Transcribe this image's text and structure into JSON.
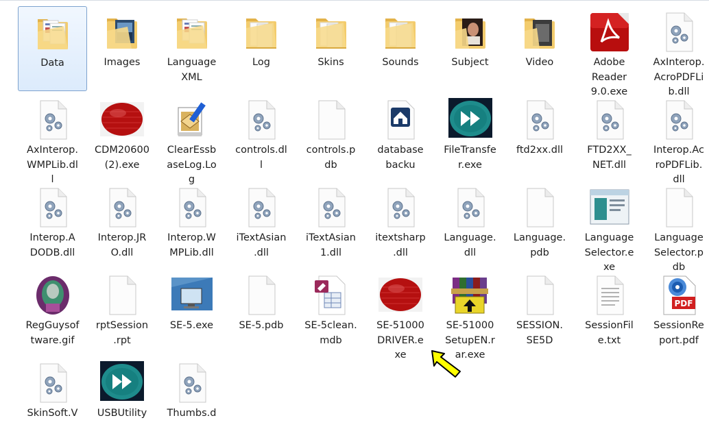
{
  "items": [
    {
      "label": "Data",
      "icon": "folder-documents-icon",
      "selected": true
    },
    {
      "label": "Images",
      "icon": "folder-images-icon"
    },
    {
      "label": "Language\nXML",
      "icon": "folder-documents-icon"
    },
    {
      "label": "Log",
      "icon": "folder-icon"
    },
    {
      "label": "Skins",
      "icon": "folder-icon"
    },
    {
      "label": "Sounds",
      "icon": "folder-icon"
    },
    {
      "label": "Subject",
      "icon": "folder-photo-icon"
    },
    {
      "label": "Video",
      "icon": "folder-video-icon"
    },
    {
      "label": "Adobe\nReader\n9.0.exe",
      "icon": "adobe-reader-icon"
    },
    {
      "label": "AxInterop.\nAcroPDFLi\nb.dll",
      "icon": "dll-gear-icon"
    },
    {
      "label": "AxInterop.\nWMPLib.dl\nl",
      "icon": "dll-gear-icon"
    },
    {
      "label": "CDM20600\n(2).exe",
      "icon": "red-disc-icon"
    },
    {
      "label": "ClearEssb\naseLog.Lo\ng",
      "icon": "log-pen-icon"
    },
    {
      "label": "controls.dl\nl",
      "icon": "dll-gear-icon"
    },
    {
      "label": "controls.p\ndb",
      "icon": "blank-file-icon"
    },
    {
      "label": "database\nbacku",
      "icon": "home-file-icon"
    },
    {
      "label": "FileTransfe\nr.exe",
      "icon": "teal-forward-icon"
    },
    {
      "label": "ftd2xx.dll",
      "icon": "dll-gear-icon"
    },
    {
      "label": "FTD2XX_\nNET.dll",
      "icon": "dll-gear-icon"
    },
    {
      "label": "Interop.Ac\nroPDFLib.\ndll",
      "icon": "dll-gear-icon"
    },
    {
      "label": "Interop.A\nDODB.dll",
      "icon": "dll-gear-icon"
    },
    {
      "label": "Interop.JR\nO.dll",
      "icon": "dll-gear-icon"
    },
    {
      "label": "Interop.W\nMPLib.dll",
      "icon": "dll-gear-icon"
    },
    {
      "label": "iTextAsian\n.dll",
      "icon": "dll-gear-icon"
    },
    {
      "label": "iTextAsian\n1.dll",
      "icon": "dll-gear-icon"
    },
    {
      "label": "itextsharp\n.dll",
      "icon": "dll-gear-icon"
    },
    {
      "label": "Language.\ndll",
      "icon": "dll-gear-icon"
    },
    {
      "label": "Language.\npdb",
      "icon": "blank-file-icon"
    },
    {
      "label": "Language\nSelector.e\nxe",
      "icon": "window-app-icon"
    },
    {
      "label": "Language\nSelector.p\ndb",
      "icon": "blank-file-icon"
    },
    {
      "label": "RegGuysof\ntware.gif",
      "icon": "gif-image-icon"
    },
    {
      "label": "rptSession\n.rpt",
      "icon": "blank-file-icon"
    },
    {
      "label": "SE-5.exe",
      "icon": "monitor-app-icon"
    },
    {
      "label": "SE-5.pdb",
      "icon": "blank-file-icon"
    },
    {
      "label": "SE-5clean.\nmdb",
      "icon": "access-db-icon"
    },
    {
      "label": "SE-51000\nDRIVER.e\nxe",
      "icon": "red-disc-icon"
    },
    {
      "label": "SE-51000\nSetupEN.r\nar.exe",
      "icon": "winrar-icon"
    },
    {
      "label": "SESSION.\nSE5D",
      "icon": "blank-file-icon"
    },
    {
      "label": "SessionFil\ne.txt",
      "icon": "text-file-icon"
    },
    {
      "label": "SessionRe\nport.pdf",
      "icon": "pdf-file-icon"
    },
    {
      "label": "SkinSoft.V",
      "icon": "dll-gear-icon"
    },
    {
      "label": "USBUtility",
      "icon": "teal-forward-icon"
    },
    {
      "label": "Thumbs.d",
      "icon": "dll-gear-icon"
    }
  ]
}
